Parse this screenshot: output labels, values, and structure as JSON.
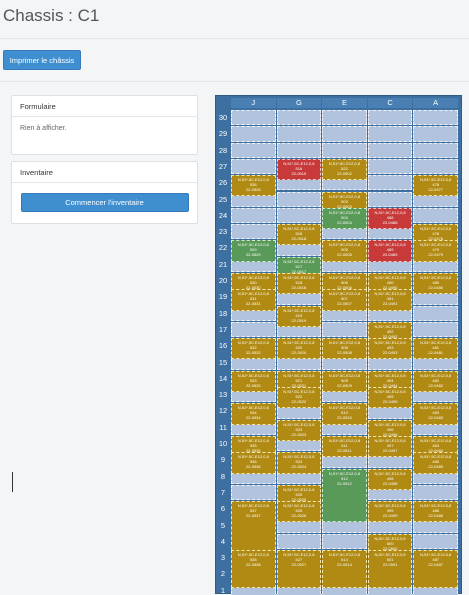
{
  "header": {
    "title": "Chassis : C1"
  },
  "toolbar": {
    "print_label": "Imprimer le châssis"
  },
  "form_panel": {
    "title": "Formulaire",
    "empty_text": "Rien à afficher."
  },
  "inventory_panel": {
    "title": "Inventaire",
    "start_label": "Commencer l'inventaire"
  },
  "chassis": {
    "columns": [
      "J",
      "G",
      "E",
      "C",
      "A"
    ],
    "rows": [
      "30",
      "29",
      "28",
      "27",
      "26",
      "25",
      "24",
      "23",
      "22",
      "21",
      "20",
      "19",
      "18",
      "17",
      "16",
      "15",
      "14",
      "13",
      "12",
      "11",
      "10",
      "9",
      "8",
      "7",
      "6",
      "5",
      "4",
      "3",
      "2",
      "1"
    ],
    "colors": {
      "gold": "#b08a12",
      "red": "#c83a3a",
      "green": "#5a9a58",
      "empty": "#b2c3de",
      "frame": "#3d6fa0"
    },
    "blocks": [
      {
        "col": 1,
        "row": 27,
        "rows": 2,
        "color": "red",
        "lines": [
          "N,51*,5C,E12,0,8",
          "516",
          "22-0515"
        ]
      },
      {
        "col": 2,
        "row": 27,
        "rows": 2,
        "color": "gold",
        "lines": [
          "N,51*,5C,E12,0,8",
          "522",
          "22-0502"
        ]
      },
      {
        "col": 0,
        "row": 26,
        "rows": 2,
        "color": "gold",
        "lines": [
          "N,51*,5C,E12,0,8",
          "536",
          "22-0526"
        ]
      },
      {
        "col": 4,
        "row": 26,
        "rows": 2,
        "color": "gold",
        "lines": [
          "N,51*,5C,E12,0,8",
          "478",
          "22-0477"
        ]
      },
      {
        "col": 2,
        "row": 25,
        "rows": 2,
        "color": "gold",
        "lines": [
          "N,51*,5C,E12,0,8",
          "503",
          "22-0503"
        ]
      },
      {
        "col": 2,
        "row": 24,
        "rows": 2,
        "color": "green",
        "lines": [
          "N,51*,5C,E12,0,8",
          "504",
          "22-0504"
        ]
      },
      {
        "col": 3,
        "row": 24,
        "rows": 2,
        "color": "red",
        "lines": [
          "N,51*,5C,E12,0,8",
          "488",
          "22-0488"
        ]
      },
      {
        "col": 1,
        "row": 23,
        "rows": 2,
        "color": "gold",
        "lines": [
          "N,51*,5C,E12,0,8",
          "518",
          "22-0518"
        ]
      },
      {
        "col": 4,
        "row": 23,
        "rows": 2,
        "color": "gold",
        "lines": [
          "N,51*,5C,E12,0,8",
          "478",
          "22-0478"
        ]
      },
      {
        "col": 0,
        "row": 22,
        "rows": 2,
        "color": "green",
        "lines": [
          "N,51*,5C,E12,0,8",
          "529",
          "22-0529"
        ]
      },
      {
        "col": 2,
        "row": 22,
        "rows": 2,
        "color": "gold",
        "lines": [
          "N,51*,5C,E12,0,8",
          "505",
          "22-0505"
        ]
      },
      {
        "col": 3,
        "row": 22,
        "rows": 2,
        "color": "red",
        "lines": [
          "N,51*,5C,E12,0,8",
          "489",
          "22-0489"
        ]
      },
      {
        "col": 4,
        "row": 22,
        "rows": 2,
        "color": "gold",
        "lines": [
          "N,51*,5C,E12,0,8",
          "479",
          "22-0479"
        ]
      },
      {
        "col": 1,
        "row": 21,
        "rows": 2,
        "color": "green",
        "lines": [
          "N,51*,5C,E12,0,8",
          "517",
          "22-0517"
        ]
      },
      {
        "col": 0,
        "row": 20,
        "rows": 2,
        "color": "gold",
        "lines": [
          "N,51*,5C,E12,0,8",
          "530",
          "22-0530"
        ]
      },
      {
        "col": 1,
        "row": 20,
        "rows": 2,
        "color": "gold",
        "lines": [
          "N,51*,5C,E12,0,8",
          "518",
          "22-0518"
        ]
      },
      {
        "col": 2,
        "row": 20,
        "rows": 2,
        "color": "gold",
        "lines": [
          "N,51*,5C,E12,0,8",
          "506",
          "22-0506"
        ]
      },
      {
        "col": 3,
        "row": 20,
        "rows": 2,
        "color": "gold",
        "lines": [
          "N,51*,5C,E12,0,8",
          "490",
          "22-0490"
        ]
      },
      {
        "col": 4,
        "row": 20,
        "rows": 2,
        "color": "gold",
        "lines": [
          "N,51*,5C,E12,0,8",
          "480",
          "22-0480"
        ]
      },
      {
        "col": 0,
        "row": 19,
        "rows": 2,
        "color": "gold",
        "lines": [
          "N,51*,5C,E12,0,8",
          "531",
          "22-0531"
        ]
      },
      {
        "col": 2,
        "row": 19,
        "rows": 2,
        "color": "gold",
        "lines": [
          "N,51*,5C,E12,0,8",
          "507",
          "22-0507"
        ]
      },
      {
        "col": 3,
        "row": 19,
        "rows": 2,
        "color": "gold",
        "lines": [
          "N,51*,5C,E12,0,8",
          "491",
          "22-0491"
        ]
      },
      {
        "col": 1,
        "row": 18,
        "rows": 2,
        "color": "gold",
        "lines": [
          "N,51*,5C,E12,0,8",
          "519",
          "22-0519"
        ]
      },
      {
        "col": 3,
        "row": 17,
        "rows": 2,
        "color": "gold",
        "lines": [
          "N,51*,5C,E12,0,8",
          "492",
          "22-0492"
        ]
      },
      {
        "col": 0,
        "row": 16,
        "rows": 2,
        "color": "gold",
        "lines": [
          "N,51*,5C,E12,0,8",
          "532",
          "22-0532"
        ]
      },
      {
        "col": 1,
        "row": 16,
        "rows": 2,
        "color": "gold",
        "lines": [
          "N,51*,5C,E12,0,8",
          "520",
          "22-0520"
        ]
      },
      {
        "col": 2,
        "row": 16,
        "rows": 2,
        "color": "gold",
        "lines": [
          "N,51*,5C,E12,0,8",
          "508",
          "22-0508"
        ]
      },
      {
        "col": 3,
        "row": 16,
        "rows": 2,
        "color": "gold",
        "lines": [
          "N,51*,5C,E12,0,8",
          "493",
          "22-0493"
        ]
      },
      {
        "col": 4,
        "row": 16,
        "rows": 2,
        "color": "gold",
        "lines": [
          "N,51*,5C,E12,0,8",
          "481",
          "22-0481"
        ]
      },
      {
        "col": 0,
        "row": 14,
        "rows": 2,
        "color": "gold",
        "lines": [
          "N,51*,5C,E12,0,8",
          "533",
          "22-0533"
        ]
      },
      {
        "col": 1,
        "row": 14,
        "rows": 2,
        "color": "gold",
        "lines": [
          "N,51*,5C,E12,0,8",
          "521",
          "22-0521"
        ]
      },
      {
        "col": 2,
        "row": 14,
        "rows": 2,
        "color": "gold",
        "lines": [
          "N,51*,5C,E12,0,8",
          "509",
          "22-0509"
        ]
      },
      {
        "col": 3,
        "row": 14,
        "rows": 2,
        "color": "gold",
        "lines": [
          "N,51*,5C,E12,0,8",
          "494",
          "22-0494"
        ]
      },
      {
        "col": 4,
        "row": 14,
        "rows": 2,
        "color": "gold",
        "lines": [
          "N,51*,5C,E12,0,8",
          "482",
          "22-0482"
        ]
      },
      {
        "col": 1,
        "row": 13,
        "rows": 2,
        "color": "gold",
        "lines": [
          "N,51*,5C,E12,0,8",
          "522",
          "22-0522"
        ]
      },
      {
        "col": 3,
        "row": 13,
        "rows": 2,
        "color": "gold",
        "lines": [
          "N,51*,5C,E12,0,8",
          "495",
          "22-0495"
        ]
      },
      {
        "col": 0,
        "row": 12,
        "rows": 2,
        "color": "gold",
        "lines": [
          "N,51*,5C,E12,0,8",
          "534",
          "22-0534"
        ]
      },
      {
        "col": 2,
        "row": 12,
        "rows": 2,
        "color": "gold",
        "lines": [
          "N,51*,5C,E12,0,8",
          "510",
          "22-0510"
        ]
      },
      {
        "col": 4,
        "row": 12,
        "rows": 2,
        "color": "gold",
        "lines": [
          "N,51*,5C,E12,0,8",
          "483",
          "22-0483"
        ]
      },
      {
        "col": 1,
        "row": 11,
        "rows": 2,
        "color": "gold",
        "lines": [
          "N,51*,5C,E12,0,8",
          "523",
          "22-0523"
        ]
      },
      {
        "col": 3,
        "row": 11,
        "rows": 2,
        "color": "gold",
        "lines": [
          "N,51*,5C,E12,0,8",
          "496",
          "22-0496"
        ]
      },
      {
        "col": 0,
        "row": 10,
        "rows": 2,
        "color": "gold",
        "lines": [
          "N,51*,5C,E12,0,8",
          "535",
          "22-0535"
        ]
      },
      {
        "col": 2,
        "row": 10,
        "rows": 2,
        "color": "gold",
        "lines": [
          "N,51*,5C,E12,0,8",
          "511",
          "22-0511"
        ]
      },
      {
        "col": 3,
        "row": 10,
        "rows": 2,
        "color": "gold",
        "lines": [
          "N,51*,5C,E12,0,8",
          "497",
          "22-0497"
        ]
      },
      {
        "col": 4,
        "row": 10,
        "rows": 2,
        "color": "gold",
        "lines": [
          "N,51*,5C,E12,0,8",
          "484",
          "22-0484"
        ]
      },
      {
        "col": 0,
        "row": 9,
        "rows": 2,
        "color": "gold",
        "lines": [
          "N,51*,5C,E12,0,8",
          "536",
          "22-0536"
        ]
      },
      {
        "col": 1,
        "row": 9,
        "rows": 2,
        "color": "gold",
        "lines": [
          "N,51*,5C,E12,0,8",
          "524",
          "22-0524"
        ]
      },
      {
        "col": 4,
        "row": 9,
        "rows": 2,
        "color": "gold",
        "lines": [
          "N,51*,5C,E12,0,8",
          "485",
          "22-0485"
        ]
      },
      {
        "col": 2,
        "row": 8,
        "rows": 4,
        "color": "green",
        "lines": [
          "N,51*,5C,E12,0,8",
          "512",
          "22-0512"
        ]
      },
      {
        "col": 3,
        "row": 8,
        "rows": 2,
        "color": "gold",
        "lines": [
          "N,51*,5C,E12,0,8",
          "498",
          "22-0498"
        ]
      },
      {
        "col": 1,
        "row": 7,
        "rows": 2,
        "color": "gold",
        "lines": [
          "N,51*,5C,E12,0,8",
          "525",
          "22-0525"
        ]
      },
      {
        "col": 0,
        "row": 6,
        "rows": 4,
        "color": "gold",
        "lines": [
          "N,51*,5C,E12,0,8",
          "537",
          "22-0537"
        ]
      },
      {
        "col": 1,
        "row": 6,
        "rows": 2,
        "color": "gold",
        "lines": [
          "N,51*,5C,E12,0,8",
          "526",
          "22-0526"
        ]
      },
      {
        "col": 3,
        "row": 6,
        "rows": 2,
        "color": "gold",
        "lines": [
          "N,51*,5C,E12,0,8",
          "499",
          "22-0499"
        ]
      },
      {
        "col": 4,
        "row": 6,
        "rows": 2,
        "color": "gold",
        "lines": [
          "N,51*,5C,E12,0,8",
          "486",
          "22-0486"
        ]
      },
      {
        "col": 3,
        "row": 4,
        "rows": 2,
        "color": "gold",
        "lines": [
          "N,51*,5C,E12,0,8",
          "500",
          "22-0500"
        ]
      },
      {
        "col": 0,
        "row": 3,
        "rows": 3,
        "color": "gold",
        "lines": [
          "N,51*,5C,E12,0,8",
          "538",
          "22-0538"
        ]
      },
      {
        "col": 1,
        "row": 3,
        "rows": 3,
        "color": "gold",
        "lines": [
          "N,51*,5C,E12,0,8",
          "527",
          "22-0527"
        ]
      },
      {
        "col": 2,
        "row": 3,
        "rows": 3,
        "color": "gold",
        "lines": [
          "N,51*,5C,E12,0,8",
          "514",
          "22-0514"
        ]
      },
      {
        "col": 3,
        "row": 3,
        "rows": 3,
        "color": "gold",
        "lines": [
          "N,51*,5C,E12,0,8",
          "501",
          "22-0501"
        ]
      },
      {
        "col": 4,
        "row": 3,
        "rows": 3,
        "color": "gold",
        "lines": [
          "N,51*,5C,E12,0,8",
          "487",
          "22-0487"
        ]
      }
    ]
  }
}
